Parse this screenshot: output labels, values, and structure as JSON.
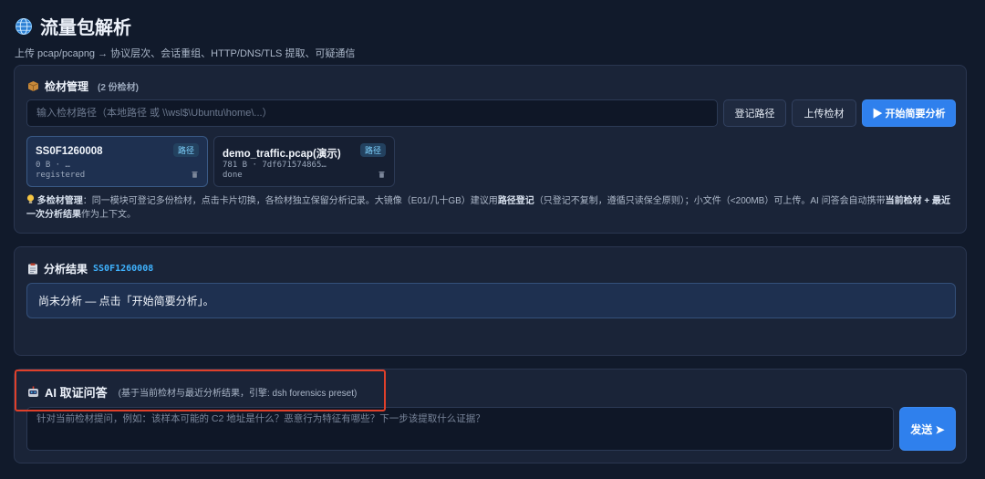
{
  "header": {
    "title": "流量包解析",
    "subtitle": "上传 pcap/pcapng → 协议层次、会话重组、HTTP/DNS/TLS 提取、可疑通信"
  },
  "evidence_panel": {
    "title": "检材管理",
    "count": "(2 份检材)",
    "path_placeholder": "输入检材路径（本地路径 或 \\\\wsl$\\Ubuntu\\home\\...）",
    "register_button": "登记路径",
    "upload_button": "上传检材",
    "analyze_button": "▶ 开始简要分析",
    "items": [
      {
        "name": "SS0F1260008",
        "badge": "路径",
        "meta": "0 B · …",
        "status": "registered"
      },
      {
        "name": "demo_traffic.pcap(演示)",
        "badge": "路径",
        "meta": "781 B · 7df671574865…",
        "status": "done"
      }
    ],
    "note": {
      "label": "多检材管理",
      "text1": "：同一模块可登记多份检材，点击卡片切换，各检材独立保留分析记录。大镜像（E01/几十GB）建议用",
      "bold": "路径登记",
      "text2": "（只登记不复制，遵循只读保全原则）；小文件（<200MB）可上传。AI 问答会自动携带",
      "bold2": "当前检材 + 最近一次分析结果",
      "text3": "作为上下文。"
    }
  },
  "result_panel": {
    "title": "分析结果",
    "evidence_id": "SS0F1260008",
    "message": "尚未分析 — 点击「开始简要分析」。"
  },
  "ai_panel": {
    "title": "AI 取证问答",
    "hint": "(基于当前检材与最近分析结果，引擎: dsh forensics preset)",
    "placeholder": "针对当前检材提问，例如：该样本可能的 C2 地址是什么？恶意行为特征有哪些？下一步该提取什么证据？",
    "send_button": "发送 ➤"
  },
  "colors": {
    "background": "#111a2b",
    "card": "#1a2438",
    "accent": "#2f80ed",
    "highlight": "#e0402a"
  }
}
